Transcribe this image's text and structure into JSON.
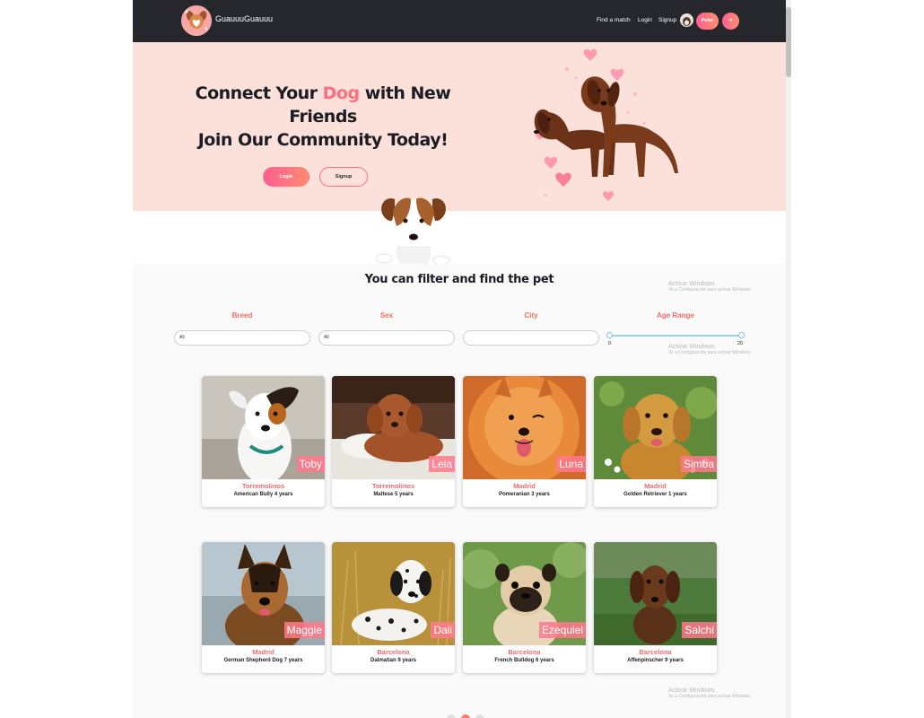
{
  "nav": {
    "brand": "GuauuuGuauuu",
    "find_match": "Find a match",
    "login": "Login",
    "signup": "Signup",
    "user_button": "Peter",
    "logout_button": "➩"
  },
  "hero": {
    "title_part1": "Connect Your ",
    "title_accent": "Dog",
    "title_part2": " with New Friends",
    "title_line2": "Join Our Community Today!",
    "login_button": "Login",
    "signup_button": "Signup"
  },
  "filters": {
    "title": "You can filter and find the pet",
    "breed_label": "Breed",
    "breed_value": "All",
    "sex_label": "Sex",
    "sex_value": "All",
    "city_label": "City",
    "city_value": "",
    "age_label": "Age Range",
    "age_min": "0",
    "age_max": "20"
  },
  "pets": [
    {
      "name": "Toby",
      "city": "Torremolinos",
      "desc": "American Bully 4 years",
      "icon": "terrier-photo"
    },
    {
      "name": "Leia",
      "city": "Torremolinos",
      "desc": "Maltese 5 years",
      "icon": "poodle-photo"
    },
    {
      "name": "Luna",
      "city": "Madrid",
      "desc": "Pomeranian 3 years",
      "icon": "pomeranian-photo"
    },
    {
      "name": "Simba",
      "city": "Madrid",
      "desc": "Golden Retriever 1 years",
      "icon": "golden-photo"
    },
    {
      "name": "Maggie",
      "city": "Madrid",
      "desc": "German Shepherd Dog 7 years",
      "icon": "shepherd-photo"
    },
    {
      "name": "Dali",
      "city": "Barcelona",
      "desc": "Dalmatian 9 years",
      "icon": "dalmatian-photo"
    },
    {
      "name": "Ezequiel",
      "city": "Barcelona",
      "desc": "French Bulldog 6 years",
      "icon": "pug-photo"
    },
    {
      "name": "Salchi",
      "city": "Barcelona",
      "desc": "Affenpinscher 9 years",
      "icon": "dachshund-photo"
    }
  ],
  "watermark": {
    "line1": "Activar Windows",
    "line2": "Ve a Configuración para activar Windows."
  },
  "colors": {
    "accent": "#ff6f7e",
    "nav_bg": "#25272c",
    "hero_bg": "#fbe1da"
  }
}
